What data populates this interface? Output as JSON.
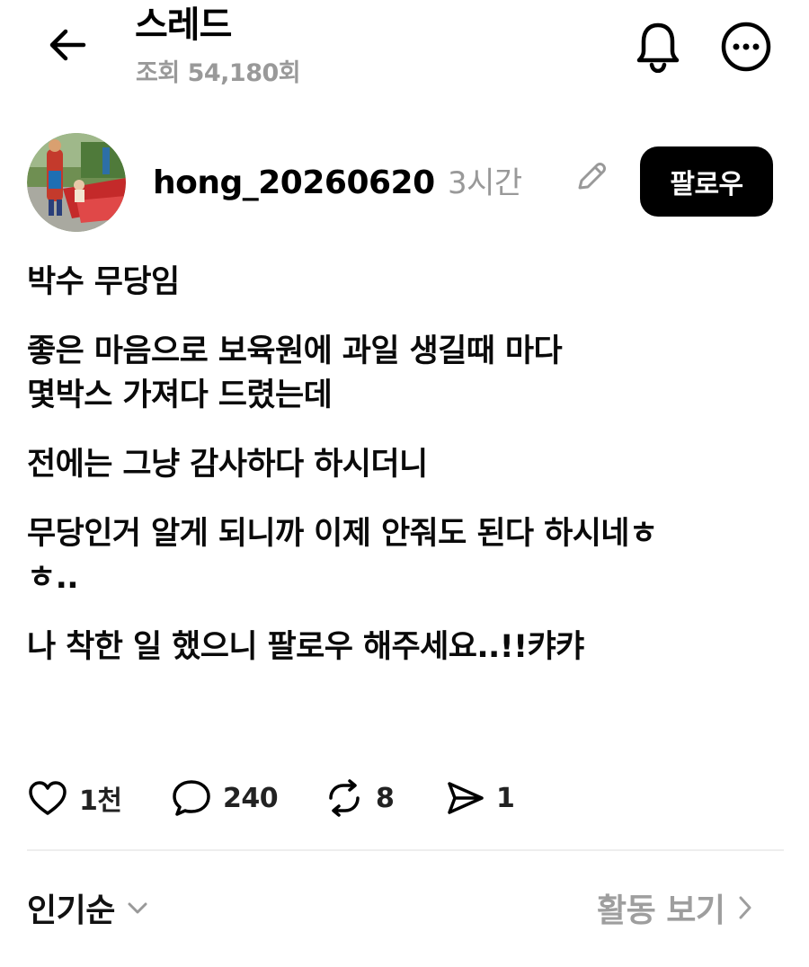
{
  "header": {
    "title": "스레드",
    "views": "조회 54,180회",
    "back_icon": "arrow-left-icon",
    "bell_icon": "bell-icon",
    "more_icon": "more-circle-icon"
  },
  "author": {
    "username": "hong_20260620",
    "time": "3시간",
    "edited_icon": "pencil-icon",
    "follow_label": "팔로우"
  },
  "post": {
    "paragraphs": [
      "박수 무당임",
      "좋은 마음으로 보육원에 과일 생길때 마다\n몇박스 가져다 드렸는데",
      "전에는 그냥 감사하다 하시더니",
      "무당인거 알게 되니까 이제 안줘도 된다 하시네ㅎ\nㅎ..",
      "나 착한 일 했으니 팔로우 해주세요..!!캬캬"
    ]
  },
  "actions": {
    "likes": "1천",
    "comments": "240",
    "reposts": "8",
    "shares": "1"
  },
  "footer": {
    "sort_label": "인기순",
    "activity_label": "활동 보기"
  },
  "colors": {
    "text": "#000000",
    "muted": "#999999",
    "follow_bg": "#000000",
    "follow_text": "#ffffff",
    "divider": "#eeeeee"
  }
}
